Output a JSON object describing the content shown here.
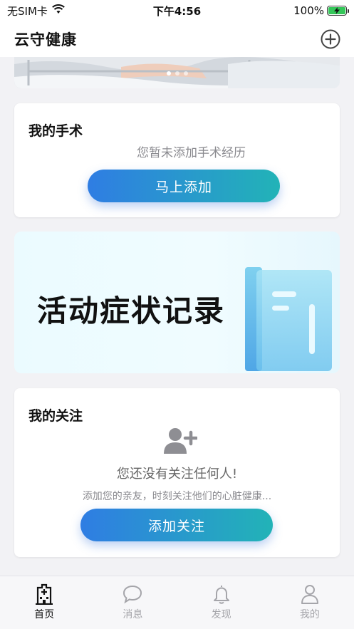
{
  "status_bar": {
    "carrier": "无SIM卡",
    "time": "下午4:56",
    "battery": "100%"
  },
  "header": {
    "title": "云守健康"
  },
  "surgery": {
    "title": "我的手术",
    "empty_text": "您暂未添加手术经历",
    "button_label": "马上添加"
  },
  "symptom_banner": {
    "title": "活动症状记录"
  },
  "follow": {
    "title": "我的关注",
    "empty_text": "您还没有关注任何人!",
    "sub_text": "添加您的亲友，时刻关注他们的心脏健康...",
    "button_label": "添加关注"
  },
  "tab_bar": {
    "items": [
      {
        "label": "首页",
        "icon": "hospital-icon",
        "active": true
      },
      {
        "label": "消息",
        "icon": "chat-bubble-icon",
        "active": false
      },
      {
        "label": "发现",
        "icon": "bell-icon",
        "active": false
      },
      {
        "label": "我的",
        "icon": "person-icon",
        "active": false
      }
    ]
  },
  "colors": {
    "accent_start": "#2f7de3",
    "accent_end": "#22b3b7",
    "battery_green": "#34c759",
    "tab_inactive": "#a5a5aa"
  }
}
